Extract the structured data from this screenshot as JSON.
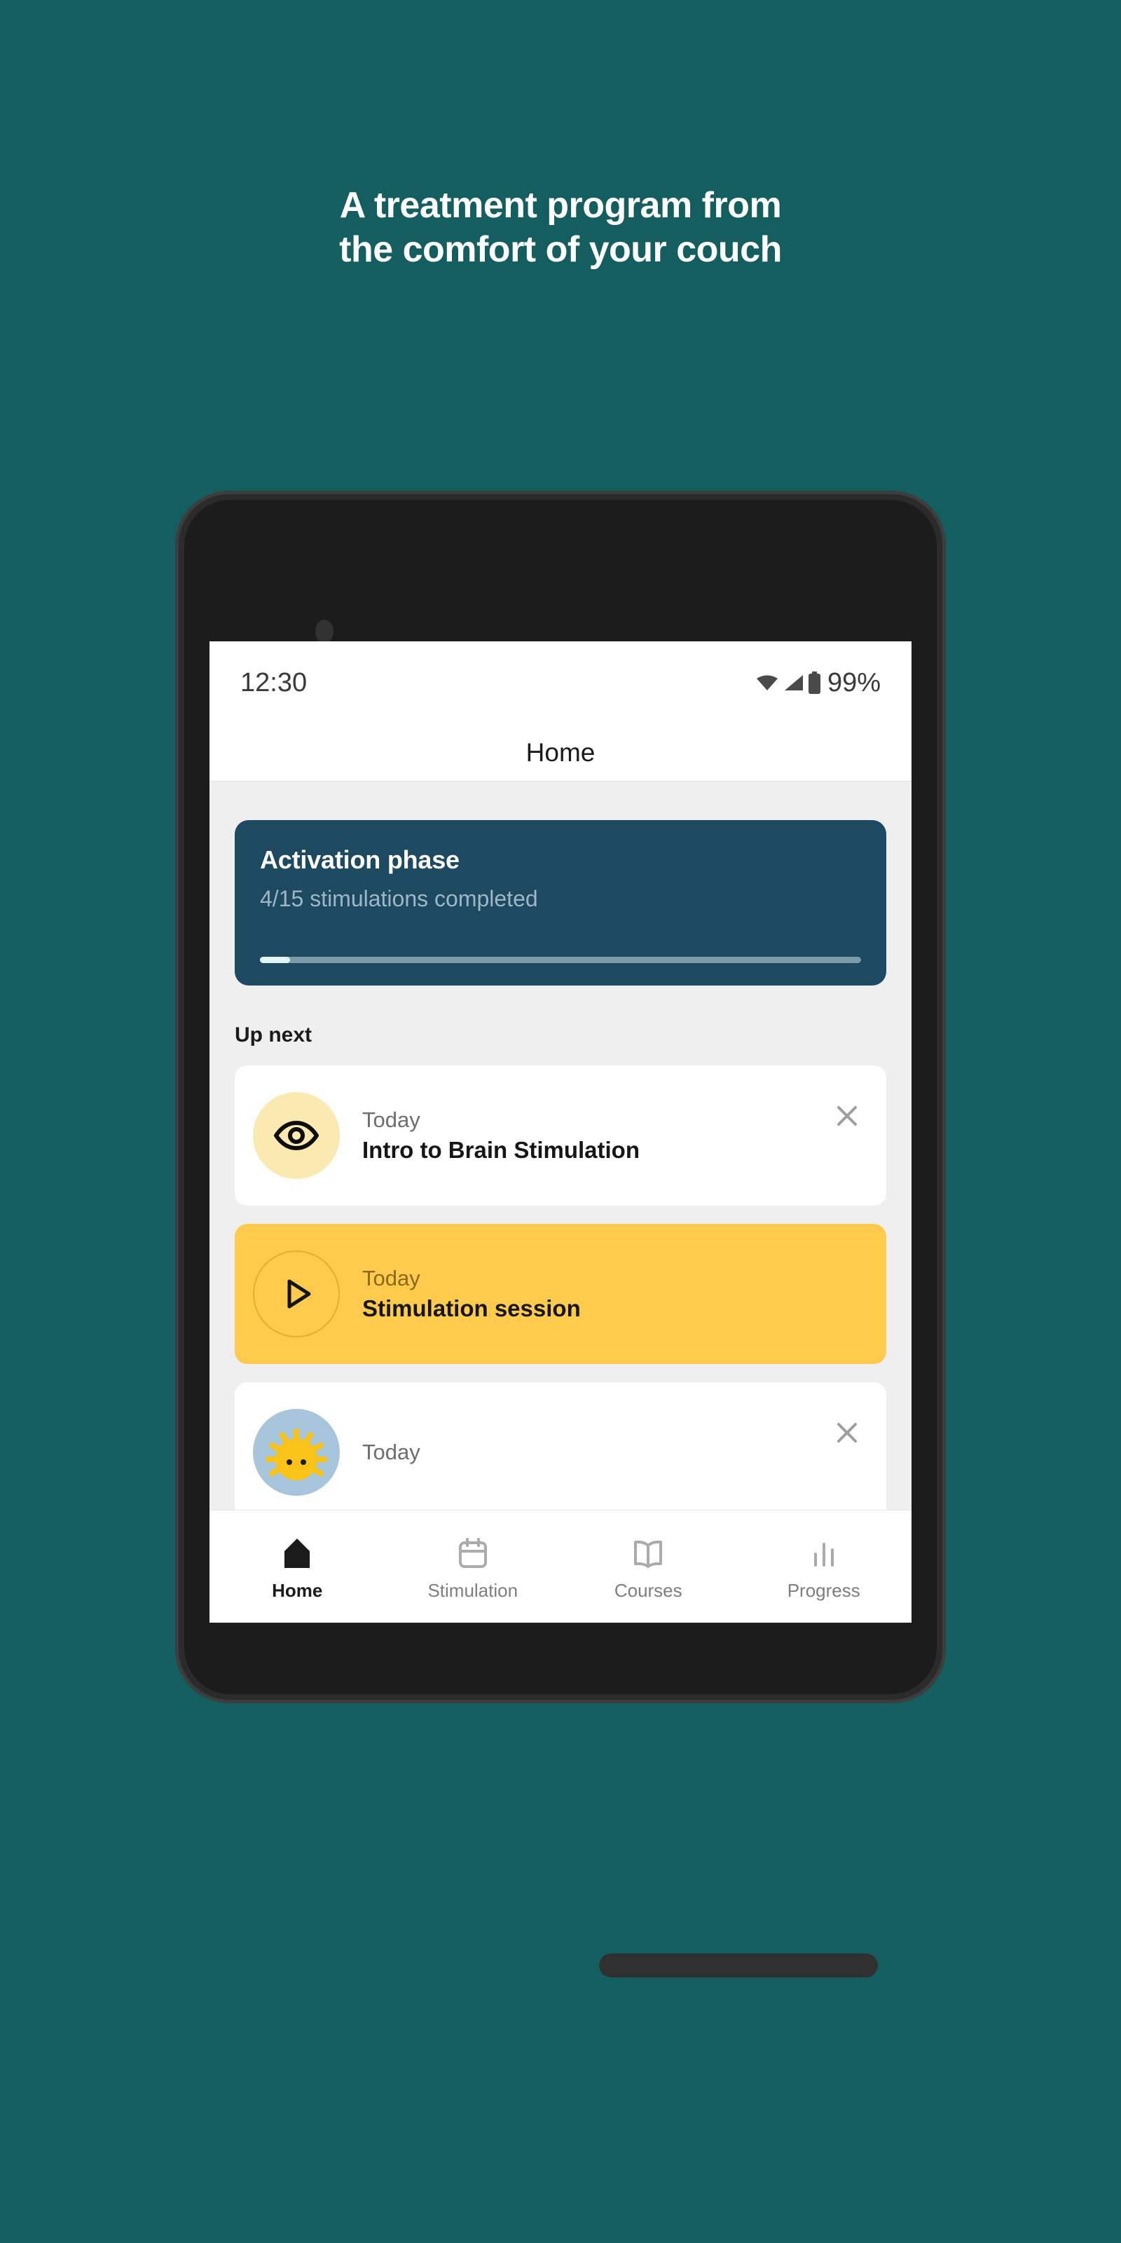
{
  "promo": {
    "headline_line1": "A treatment program from",
    "headline_line2": "the comfort of your couch",
    "background_color": "#145E5F"
  },
  "phone": {
    "camera_icon": "camera-dot",
    "speaker_icon": "earpiece-speaker",
    "bottom_bar_icon": "home-indicator"
  },
  "status_bar": {
    "time": "12:30",
    "wifi_icon": "wifi-icon",
    "signal_icon": "signal-icon",
    "battery_icon": "battery-icon",
    "battery_percent": "99%"
  },
  "app_bar": {
    "title": "Home"
  },
  "phase_card": {
    "title": "Activation phase",
    "subtitle": "4/15 stimulations completed",
    "progress_percent": 5,
    "card_color": "#1D4A61",
    "fill_color": "#E3F4F4",
    "track_color": "#7D9AAB"
  },
  "up_next": {
    "section_title": "Up next",
    "items": [
      {
        "when": "Today",
        "title": "Intro to Brain Stimulation",
        "icon": "eye-icon",
        "icon_bg": "#FAE9B0",
        "card_bg": "#FFFFFF",
        "dismissible": true,
        "close_icon": "close-icon"
      },
      {
        "when": "Today",
        "title": "Stimulation session",
        "icon": "play-icon",
        "icon_bg": "transparent",
        "card_bg": "#FFCB4C",
        "dismissible": false,
        "close_icon": ""
      },
      {
        "when": "Today",
        "title": "",
        "icon": "sunrise-face-icon",
        "icon_bg": "#A8C6DB",
        "card_bg": "#FFFFFF",
        "dismissible": true,
        "close_icon": "close-icon"
      }
    ]
  },
  "bottom_nav": {
    "items": [
      {
        "label": "Home",
        "icon": "home-icon",
        "active": true
      },
      {
        "label": "Stimulation",
        "icon": "calendar-icon",
        "active": false
      },
      {
        "label": "Courses",
        "icon": "book-icon",
        "active": false
      },
      {
        "label": "Progress",
        "icon": "bar-chart-icon",
        "active": false
      }
    ]
  }
}
